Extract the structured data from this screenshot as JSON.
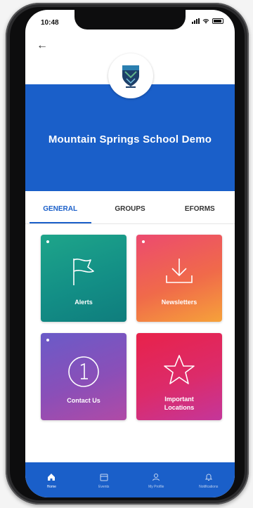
{
  "status_bar": {
    "time": "10:48"
  },
  "header": {
    "title": "Mountain Springs School Demo"
  },
  "tabs": [
    {
      "label": "GENERAL"
    },
    {
      "label": "GROUPS"
    },
    {
      "label": "EFORMS"
    }
  ],
  "tiles": [
    {
      "label": "Alerts"
    },
    {
      "label": "Newsletters"
    },
    {
      "label": "Contact Us"
    },
    {
      "label": "Important Locations"
    }
  ],
  "bottom_nav": [
    {
      "label": "Home"
    },
    {
      "label": "Events"
    },
    {
      "label": "My Profile"
    },
    {
      "label": "Notifications"
    }
  ],
  "colors": {
    "primary_blue": "#1a5fc9",
    "alerts": "#138f86",
    "newsletters": "#f06a4a",
    "contact_us": "#8a4fb8",
    "important_locations": "#dc2b6a"
  }
}
